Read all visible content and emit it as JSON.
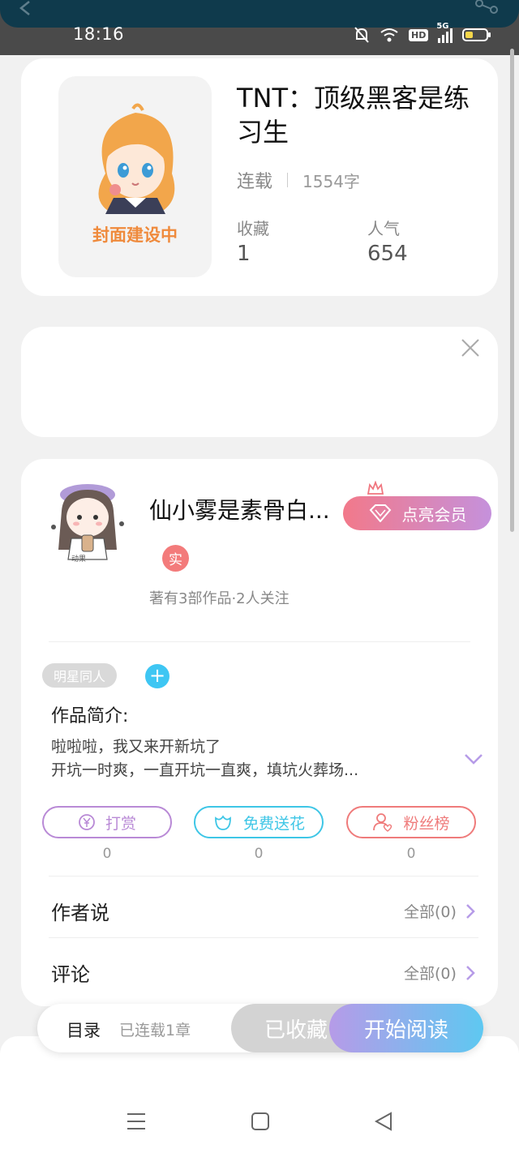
{
  "status_bar": {
    "time": "18:16",
    "network": "5G",
    "hd": "HD"
  },
  "book": {
    "title": "TNT：顶级黑客是练习生",
    "cover_text": "封面建设中",
    "status": "连载",
    "word_count": "1554字",
    "favorites_label": "收藏",
    "favorites_value": "1",
    "popularity_label": "人气",
    "popularity_value": "654"
  },
  "author": {
    "name": "仙小雾是素骨白...",
    "verified_badge": "实",
    "meta": "著有3部作品·2人关注",
    "avatar_text": "动果",
    "vip_button": "点亮会员"
  },
  "tags": [
    "明星同人"
  ],
  "add_tag_label": "+",
  "intro": {
    "heading": "作品简介:",
    "line1": "啦啦啦，我又来开新坑了",
    "line2": "开坑一时爽，一直开坑一直爽，填坑火葬场..."
  },
  "actions": [
    {
      "label": "打赏",
      "count": "0",
      "color": "#b98ad6",
      "icon": "yen-circle-icon"
    },
    {
      "label": "免费送花",
      "count": "0",
      "color": "#3ec6e6",
      "icon": "flower-icon"
    },
    {
      "label": "粉丝榜",
      "count": "0",
      "color": "#ef7b7b",
      "icon": "fan-person-icon"
    }
  ],
  "sections": [
    {
      "title": "作者说",
      "link": "全部(0)"
    },
    {
      "title": "评论",
      "link": "全部(0)"
    }
  ],
  "bottom_bar": {
    "toc_label": "目录",
    "toc_sub": "已连载1章",
    "collected_button": "已收藏",
    "read_button": "开始阅读"
  },
  "colors": {
    "accent_purple": "#b69be8",
    "accent_blue": "#5ec8f1",
    "vip_pink": "#f2798a"
  }
}
